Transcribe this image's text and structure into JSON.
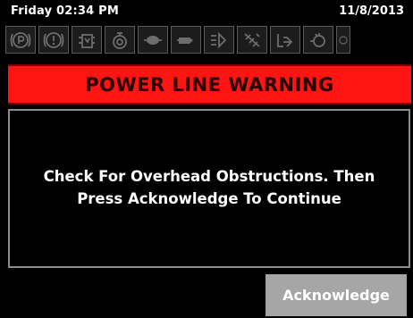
{
  "status_bar": {
    "day_time": "Friday 02:34 PM",
    "date": "11/8/2013"
  },
  "indicators": [
    {
      "icon": "parking-brake-icon"
    },
    {
      "icon": "warning-triangle-icon"
    },
    {
      "icon": "hydraulic-oil-icon"
    },
    {
      "icon": "engine-temperature-icon"
    },
    {
      "icon": "outrigger-icon"
    },
    {
      "icon": "engine-check-icon"
    },
    {
      "icon": "boom-extend-icon"
    },
    {
      "icon": "boom-swing-icon"
    },
    {
      "icon": "boom-retract-icon"
    },
    {
      "icon": "winch-icon"
    },
    {
      "icon": "wheel-icon"
    }
  ],
  "warning": {
    "title": "POWER LINE WARNING"
  },
  "message": {
    "line1": "Check For Overhead Obstructions. Then",
    "line2": "Press Acknowledge To Continue"
  },
  "actions": {
    "acknowledge_label": "Acknowledge"
  },
  "colors": {
    "banner": "#ff1414",
    "button": "#a6a6a6",
    "background": "#000000"
  }
}
